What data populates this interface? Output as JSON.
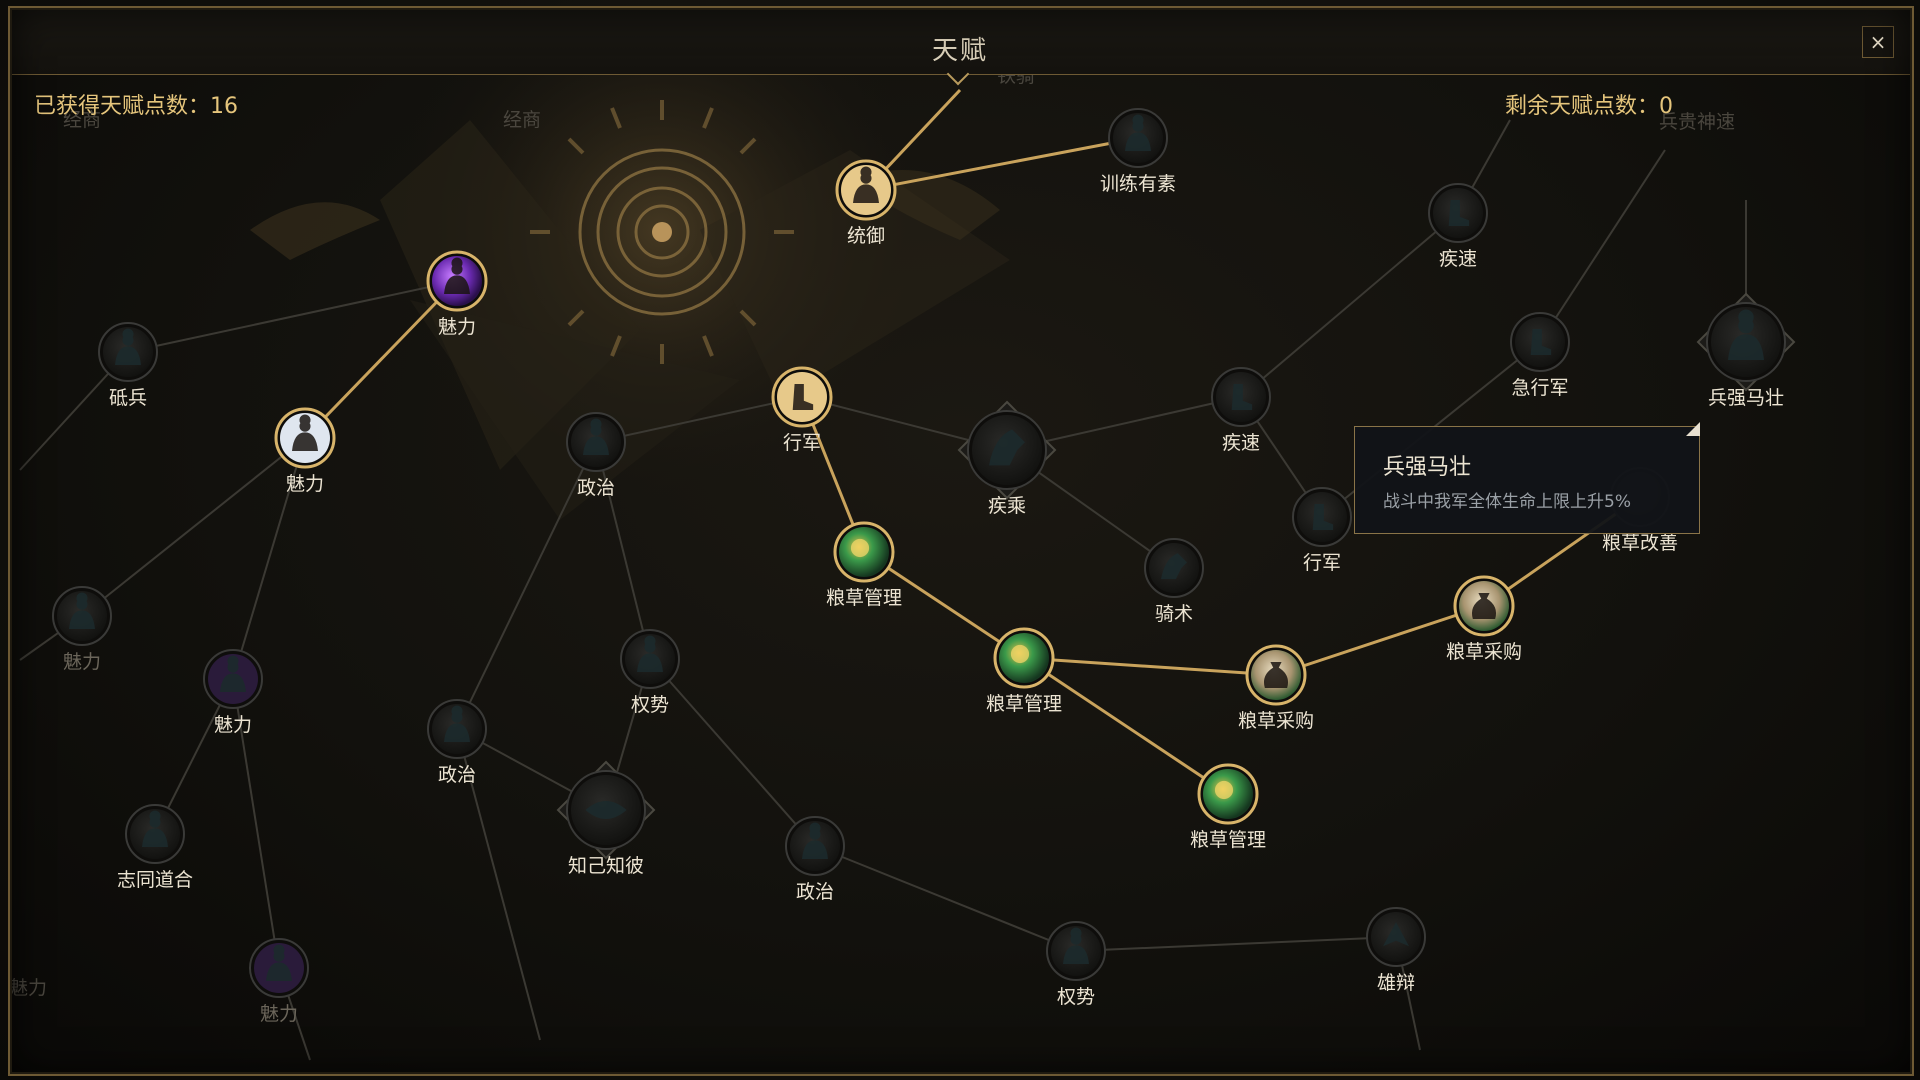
{
  "window": {
    "title": "天赋",
    "close_label": "×"
  },
  "points": {
    "gained": "已获得天赋点数：16",
    "remaining": "剩余天赋点数：0"
  },
  "background_labels": [
    "经商",
    "经商",
    "铁骑",
    "兵贵神速",
    "魅力",
    "魅力"
  ],
  "nodes": [
    {
      "id": "tongyu",
      "label": "统御",
      "state": "active",
      "icon": "warrior-icon"
    },
    {
      "id": "xunlian",
      "label": "训练有素",
      "state": "available",
      "icon": "training-icon"
    },
    {
      "id": "meili1",
      "label": "魅力",
      "state": "active",
      "icon": "purple-spirit-icon"
    },
    {
      "id": "meili2",
      "label": "魅力",
      "state": "active",
      "icon": "hooded-figure-icon"
    },
    {
      "id": "dibing",
      "label": "砥兵",
      "state": "locked",
      "icon": "soldiers-icon"
    },
    {
      "id": "xingjun1",
      "label": "行军",
      "state": "active",
      "icon": "boot-icon"
    },
    {
      "id": "zhengzhi1",
      "label": "政治",
      "state": "locked",
      "icon": "figure-icon"
    },
    {
      "id": "jicheng",
      "label": "疾乘",
      "state": "locked",
      "icon": "horse-icon"
    },
    {
      "id": "jisu1",
      "label": "疾速",
      "state": "locked",
      "icon": "boot-icon"
    },
    {
      "id": "jisu2",
      "label": "疾速",
      "state": "locked",
      "icon": "boot-icon"
    },
    {
      "id": "jixingjun",
      "label": "急行军",
      "state": "locked",
      "icon": "boot-icon"
    },
    {
      "id": "bingqiang",
      "label": "兵强马壮",
      "state": "locked",
      "icon": "army-icon"
    },
    {
      "id": "xingjun2",
      "label": "行军",
      "state": "locked",
      "icon": "boot-icon"
    },
    {
      "id": "liangcaogaishan",
      "label": "粮草改善",
      "state": "locked",
      "icon": "grain-icon"
    },
    {
      "id": "liangcao1",
      "label": "粮草管理",
      "state": "active",
      "icon": "grain-orb-icon"
    },
    {
      "id": "liangcao2",
      "label": "粮草管理",
      "state": "active",
      "icon": "grain-orb-icon"
    },
    {
      "id": "liangcao3",
      "label": "粮草管理",
      "state": "active",
      "icon": "grain-orb-icon"
    },
    {
      "id": "caigou1",
      "label": "粮草采购",
      "state": "active",
      "icon": "grain-sack-icon"
    },
    {
      "id": "caigou2",
      "label": "粮草采购",
      "state": "active",
      "icon": "grain-sack-icon"
    },
    {
      "id": "qishu",
      "label": "骑术",
      "state": "locked",
      "icon": "horse-icon"
    },
    {
      "id": "meili3",
      "label": "魅力",
      "state": "locked",
      "icon": "hooded-figure-icon"
    },
    {
      "id": "meili4",
      "label": "魅力",
      "state": "locked",
      "icon": "purple-spirit-icon"
    },
    {
      "id": "zhitong",
      "label": "志同道合",
      "state": "locked",
      "icon": "figure-icon"
    },
    {
      "id": "meili5",
      "label": "魅力",
      "state": "locked",
      "icon": "purple-spirit-icon"
    },
    {
      "id": "quanshi1",
      "label": "权势",
      "state": "locked",
      "icon": "figure-icon"
    },
    {
      "id": "zhengzhi2",
      "label": "政治",
      "state": "locked",
      "icon": "figure-icon"
    },
    {
      "id": "zhiji",
      "label": "知己知彼",
      "state": "locked",
      "icon": "eye-icon"
    },
    {
      "id": "zhengzhi3",
      "label": "政治",
      "state": "locked",
      "icon": "figure-icon"
    },
    {
      "id": "quanshi2",
      "label": "权势",
      "state": "locked",
      "icon": "figure-icon"
    },
    {
      "id": "xiongbian",
      "label": "雄辩",
      "state": "locked",
      "icon": "dragon-icon"
    }
  ],
  "tooltip": {
    "title": "兵强马壮",
    "description": "战斗中我军全体生命上限上升5%"
  },
  "colors": {
    "active_ring": "#d8b46a",
    "locked_ring": "#3a3a38",
    "active_line": "#c9a35c",
    "locked_line": "#3b3933",
    "accent": "#e5c57c"
  }
}
